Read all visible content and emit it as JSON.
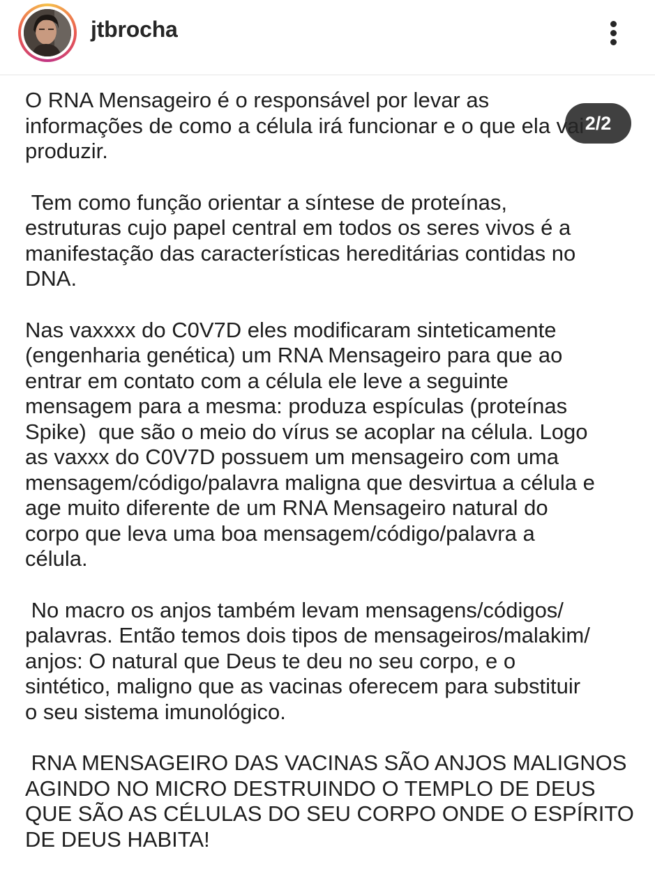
{
  "header": {
    "username": "jtbrocha",
    "avatar_icon": "profile-photo",
    "more_icon": "vertical-ellipsis-icon"
  },
  "carousel": {
    "counter": "2/2"
  },
  "post": {
    "paragraphs": [
      "O RNA Mensageiro é o responsável por levar as\ninformações de como a célula irá funcionar e o que ela vai\nproduzir.",
      " Tem como função orientar a síntese de proteínas,\nestruturas cujo papel central em todos os seres vivos é a\nmanifestação das características hereditárias contidas no\nDNA.",
      "Nas vaxxxx do C0V7D eles modificaram sinteticamente\n(engenharia genética) um RNA Mensageiro para que ao\nentrar em contato com a célula ele leve a seguinte\nmensagem para a mesma: produza espículas (proteínas\nSpike)  que são o meio do vírus se acoplar na célula. Logo\nas vaxxx do C0V7D possuem um mensageiro com uma\nmensagem/código/palavra maligna que desvirtua a célula e\nage muito diferente de um RNA Mensageiro natural do\ncorpo que leva uma boa mensagem/código/palavra a\ncélula.",
      " No macro os anjos também levam mensagens/códigos/\npalavras. Então temos dois tipos de mensageiros/malakim/\nanjos: O natural que Deus te deu no seu corpo, e o\nsintético, maligno que as vacinas oferecem para substituir\no seu sistema imunológico.",
      " RNA MENSAGEIRO DAS VACINAS SÃO ANJOS MALIGNOS\nAGINDO NO MICRO DESTRUINDO O TEMPLO DE DEUS\nQUE SÃO AS CÉLULAS DO SEU CORPO ONDE O ESPÍRITO\nDE DEUS HABITA!"
    ]
  },
  "colors": {
    "ring_gradient": [
      "#f6c14b",
      "#e95950",
      "#c13584"
    ],
    "text": "#1d1d1d",
    "counter_bg": "#262626"
  }
}
